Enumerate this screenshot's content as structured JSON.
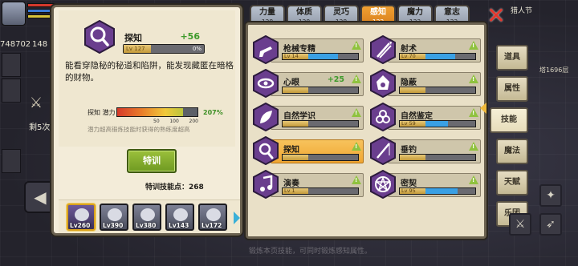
{
  "hud": {
    "gold": "748702",
    "floor_count": "148",
    "hp_label": "HP",
    "revive": "剩5次",
    "top_right": "猎人节",
    "tower": "塔1696层"
  },
  "detail": {
    "name": "探知",
    "plus": "+56",
    "level": "Lv 127",
    "progress_label": "0%",
    "progress": 0.0,
    "description": "能看穿隐秘的秘道和陷阱，能发现藏匿在暗格的财物。",
    "potential_label": "探知 潜力",
    "potential_pct": "207%",
    "potential_fill": 0.82,
    "ticks": [
      "50",
      "100",
      "200"
    ],
    "hint": "潜力超高锻炼技能时获得的熟练度超高",
    "train_button": "特训",
    "train_points_label": "特训技能点：",
    "train_points": "268"
  },
  "party": [
    {
      "level": "Lv260",
      "active": true
    },
    {
      "level": "Lv390",
      "active": false
    },
    {
      "level": "Lv380",
      "active": false
    },
    {
      "level": "Lv143",
      "active": false
    },
    {
      "level": "Lv172",
      "active": false
    }
  ],
  "tabs": [
    {
      "label": "力量",
      "count": "128"
    },
    {
      "label": "体质",
      "count": "128"
    },
    {
      "label": "灵巧",
      "count": "128"
    },
    {
      "label": "感知",
      "count": "133"
    },
    {
      "label": "魔力",
      "count": "133"
    },
    {
      "label": "意志",
      "count": "133"
    }
  ],
  "skills": [
    {
      "name": "枪械专精",
      "level": "Lv 14",
      "plus": "",
      "fill": 0.6,
      "up": true
    },
    {
      "name": "射术",
      "level": "Lv 70",
      "plus": "",
      "fill": 0.6,
      "up": true
    },
    {
      "name": "心眼",
      "level": "",
      "plus": "+25",
      "fill": 0.0,
      "up": true
    },
    {
      "name": "隐蔽",
      "level": "",
      "plus": "",
      "fill": 0.0,
      "up": true
    },
    {
      "name": "自然学识",
      "level": "",
      "plus": "",
      "fill": 0.0,
      "up": true
    },
    {
      "name": "自然鉴定",
      "level": "Lv 59",
      "plus": "",
      "fill": 0.45,
      "up": true
    },
    {
      "name": "探知",
      "level": "",
      "plus": "",
      "fill": 0.0,
      "up": true,
      "selected": true
    },
    {
      "name": "垂钓",
      "level": "",
      "plus": "",
      "fill": 0.0,
      "up": true
    },
    {
      "name": "演奏",
      "level": "Lv 1",
      "plus": "",
      "fill": 0.0,
      "up": true
    },
    {
      "name": "密契",
      "level": "Lv 95",
      "plus": "",
      "fill": 0.65,
      "up": true
    }
  ],
  "side_tabs": [
    "道具",
    "属性",
    "技能",
    "魔法",
    "天赋",
    "乐团"
  ],
  "bottom_hint": "锻炼本页技能，可同时锻炼感知属性。",
  "colors": {
    "accent_orange": "#f0a032",
    "green": "#3d9a2a",
    "bar_blue": "#3aa0e4"
  }
}
